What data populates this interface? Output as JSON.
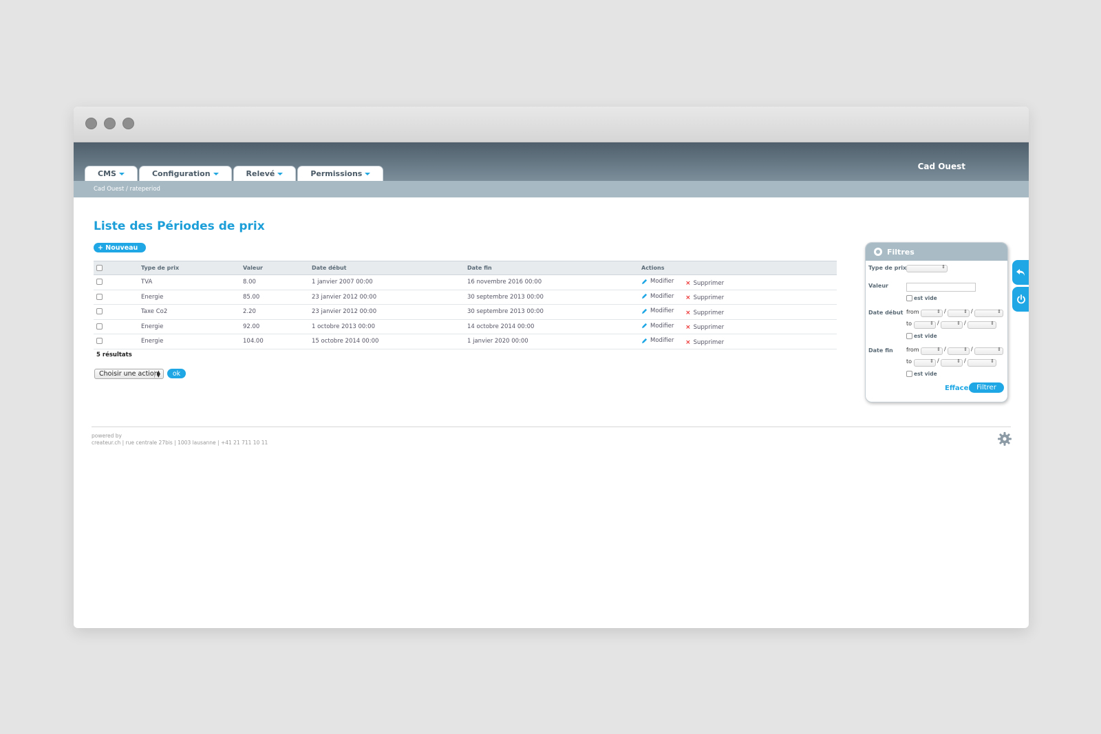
{
  "header": {
    "site_name": "Cad Ouest",
    "tabs": [
      {
        "label": "CMS"
      },
      {
        "label": "Configuration"
      },
      {
        "label": "Relevé"
      },
      {
        "label": "Permissions"
      }
    ]
  },
  "breadcrumb": "Cad Ouest / rateperiod",
  "page": {
    "title": "Liste des Périodes de prix",
    "new_button": "+ Nouveau"
  },
  "table": {
    "columns": [
      "Type de prix",
      "Valeur",
      "Date début",
      "Date fin",
      "Actions"
    ],
    "rows": [
      {
        "type": "TVA",
        "value": "8.00",
        "start": "1 janvier 2007 00:00",
        "end": "16 novembre 2016 00:00"
      },
      {
        "type": "Energie",
        "value": "85.00",
        "start": "23 janvier 2012 00:00",
        "end": "30 septembre 2013 00:00"
      },
      {
        "type": "Taxe Co2",
        "value": "2.20",
        "start": "23 janvier 2012 00:00",
        "end": "30 septembre 2013 00:00"
      },
      {
        "type": "Energie",
        "value": "92.00",
        "start": "1 octobre 2013 00:00",
        "end": "14 octobre 2014 00:00"
      },
      {
        "type": "Energie",
        "value": "104.00",
        "start": "15 octobre 2014 00:00",
        "end": "1 janvier 2020 00:00"
      }
    ],
    "edit_label": "Modifier",
    "delete_label": "Supprimer",
    "results": "5 résultats"
  },
  "bulk": {
    "select_value": "Choisir une action",
    "ok_label": "ok"
  },
  "filters": {
    "title": "Filtres",
    "type_label": "Type de prix",
    "value_label": "Valeur",
    "start_label": "Date début",
    "end_label": "Date fin",
    "from": "from",
    "to": "to",
    "empty_label": "est vide",
    "clear_label": "Effacer",
    "submit_label": "Filtrer"
  },
  "footer": {
    "powered_by": "powered by",
    "address": "createur.ch | rue centrale 27bis | 1003 lausanne | +41 21 711 10 11"
  },
  "colors": {
    "accent": "#1ea7e4",
    "header": "#5f7280",
    "breadcrumb_bar": "#a7b9c3"
  }
}
